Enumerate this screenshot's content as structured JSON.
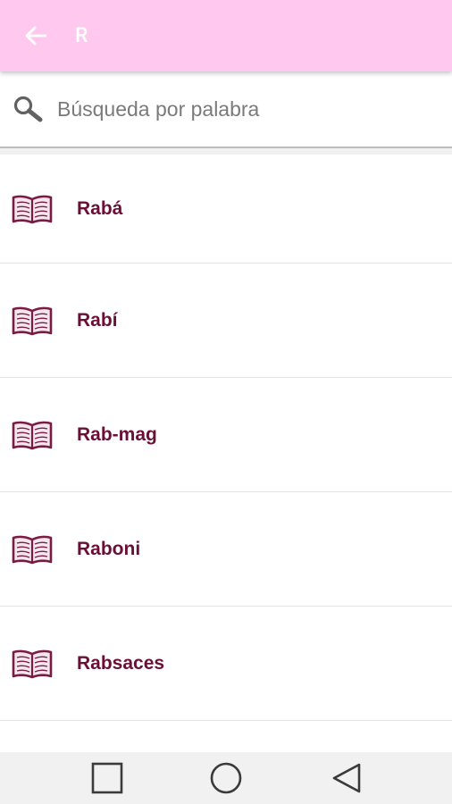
{
  "appbar": {
    "title": "R",
    "background_color": "#ffc8ee",
    "back_icon": "arrow-left-icon"
  },
  "search": {
    "placeholder": "Búsqueda por palabra",
    "value": "",
    "icon": "search-icon"
  },
  "list": {
    "item_icon": "open-book-icon",
    "label_color": "#6a1037",
    "items": [
      {
        "label": "Rabá"
      },
      {
        "label": "Rabí"
      },
      {
        "label": "Rab-mag"
      },
      {
        "label": "Raboni"
      },
      {
        "label": "Rabsaces"
      }
    ]
  },
  "navbar": {
    "buttons": [
      "recents-square-icon",
      "home-circle-icon",
      "back-triangle-icon"
    ]
  }
}
